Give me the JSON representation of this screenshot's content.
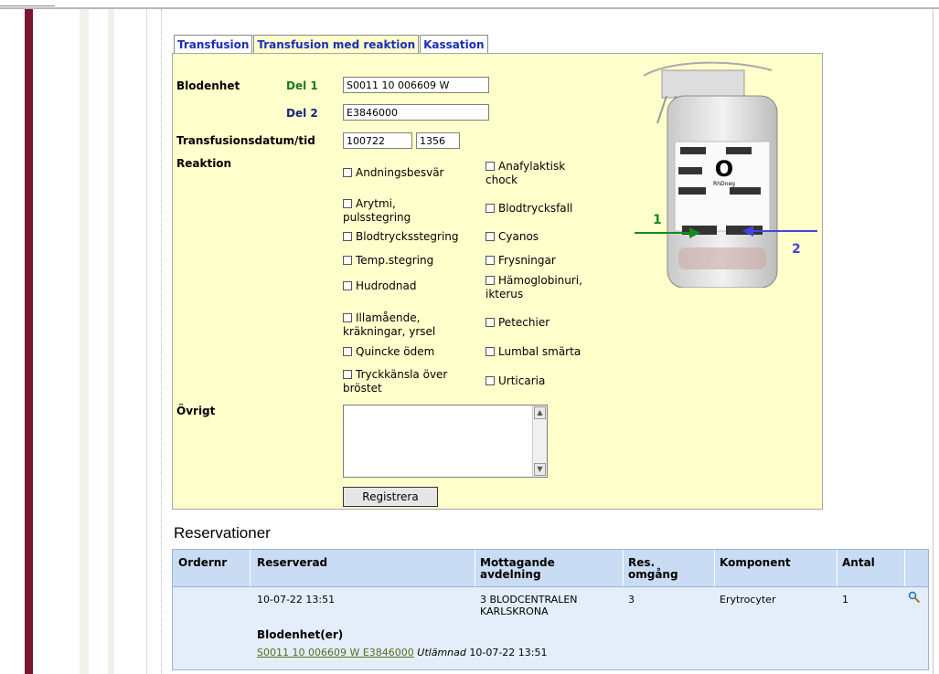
{
  "tabs": [
    "Transfusion",
    "Transfusion med reaktion",
    "Kassation"
  ],
  "form": {
    "blodenhet_label": "Blodenhet",
    "del1_label": "Del 1",
    "del1_value": "S0011 10 006609 W",
    "del2_label": "Del 2",
    "del2_value": "E3846000",
    "datetime_label": "Transfusionsdatum/tid",
    "date_value": "100722",
    "time_value": "1356",
    "reaktion_label": "Reaktion",
    "reactions_left": [
      [
        "Andningsbesvär",
        ""
      ],
      [
        "Arytmi,",
        "pulsstegring"
      ],
      [
        "Blodtrycksstegring",
        ""
      ],
      [
        "Temp.stegring",
        ""
      ],
      [
        "Hudrodnad",
        ""
      ],
      [
        "Illamående,",
        "kräkningar, yrsel"
      ],
      [
        "Quincke ödem",
        ""
      ],
      [
        "Tryckkänsla över",
        "bröstet"
      ]
    ],
    "reactions_right": [
      [
        "Anafylaktisk",
        "chock"
      ],
      [
        "Blodtrycksfall",
        ""
      ],
      [
        "Cyanos",
        ""
      ],
      [
        "Frysningar",
        ""
      ],
      [
        "Hämoglobinuri,",
        "ikterus"
      ],
      [
        "Petechier",
        ""
      ],
      [
        "Lumbal smärta",
        ""
      ],
      [
        "Urticaria",
        ""
      ]
    ],
    "ovrigt_label": "Övrigt",
    "register_label": "Registrera"
  },
  "bag": {
    "marker1": "1",
    "marker2": "2",
    "blood_group": "O",
    "rh": "RhDneg"
  },
  "reservations": {
    "title": "Reservationer",
    "headers": [
      "Ordernr",
      "Reserverad",
      "Mottagande avdelning",
      "Res. omgång",
      "Komponent",
      "Antal"
    ],
    "row": {
      "ordernr": "",
      "reserverad": "10-07-22 13:51",
      "avdelning_1": "3 BLODCENTRALEN",
      "avdelning_2": "KARLSKRONA",
      "omgang": "3",
      "komponent": "Erytrocyter",
      "antal": "1"
    },
    "blodenheter_label": "Blodenhet(er)",
    "blodenhet_link": "S0011 10 006609 W E3846000",
    "status": "Utlämnad",
    "status_time": "10-07-22 13:51"
  },
  "colors": {
    "panel": "#ffffcc",
    "tab_text": "#1a2fb8",
    "table_bg": "#e3eefa",
    "arrow1": "#1a8a1a",
    "arrow2": "#4444dd"
  }
}
